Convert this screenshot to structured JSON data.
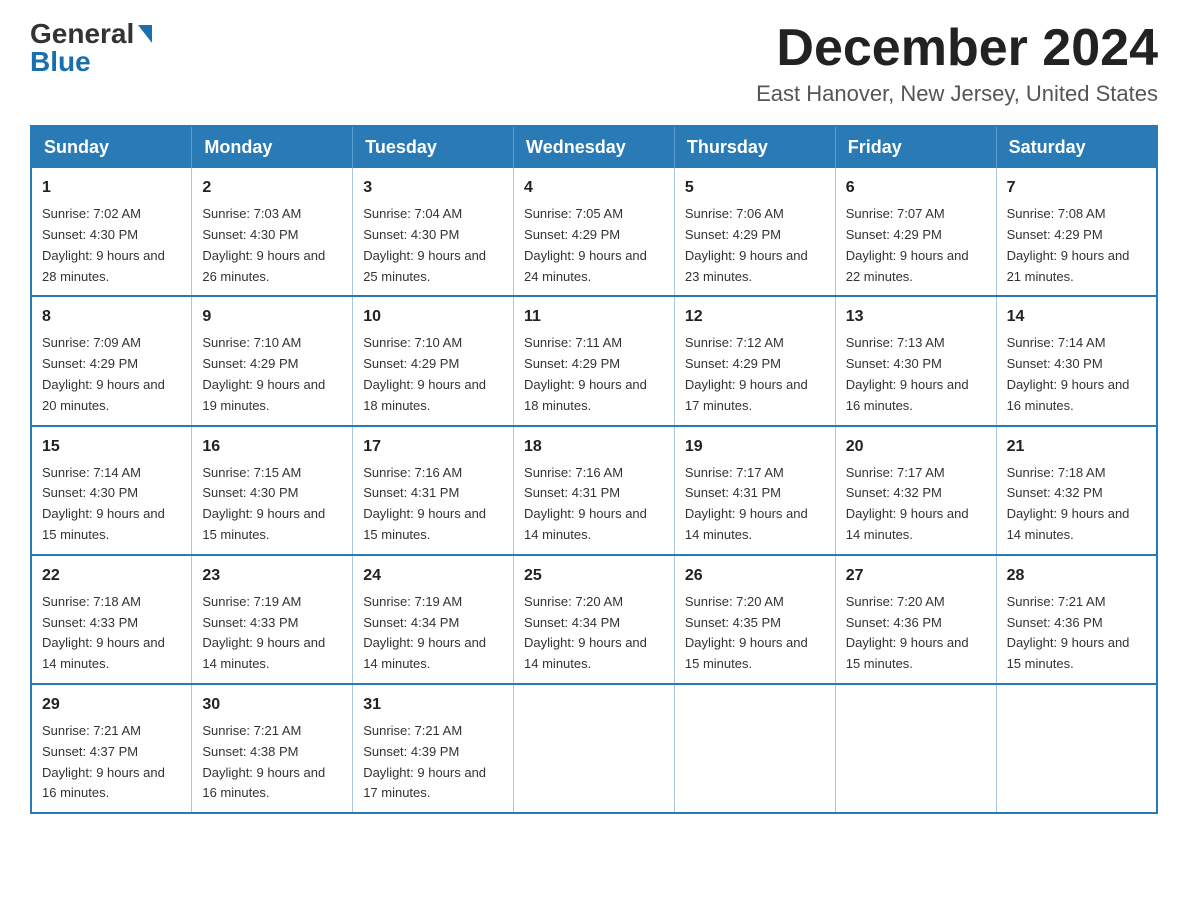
{
  "logo": {
    "general": "General",
    "blue": "Blue"
  },
  "title": {
    "month": "December 2024",
    "location": "East Hanover, New Jersey, United States"
  },
  "days_of_week": [
    "Sunday",
    "Monday",
    "Tuesday",
    "Wednesday",
    "Thursday",
    "Friday",
    "Saturday"
  ],
  "weeks": [
    [
      {
        "day": "1",
        "sunrise": "7:02 AM",
        "sunset": "4:30 PM",
        "daylight": "9 hours and 28 minutes."
      },
      {
        "day": "2",
        "sunrise": "7:03 AM",
        "sunset": "4:30 PM",
        "daylight": "9 hours and 26 minutes."
      },
      {
        "day": "3",
        "sunrise": "7:04 AM",
        "sunset": "4:30 PM",
        "daylight": "9 hours and 25 minutes."
      },
      {
        "day": "4",
        "sunrise": "7:05 AM",
        "sunset": "4:29 PM",
        "daylight": "9 hours and 24 minutes."
      },
      {
        "day": "5",
        "sunrise": "7:06 AM",
        "sunset": "4:29 PM",
        "daylight": "9 hours and 23 minutes."
      },
      {
        "day": "6",
        "sunrise": "7:07 AM",
        "sunset": "4:29 PM",
        "daylight": "9 hours and 22 minutes."
      },
      {
        "day": "7",
        "sunrise": "7:08 AM",
        "sunset": "4:29 PM",
        "daylight": "9 hours and 21 minutes."
      }
    ],
    [
      {
        "day": "8",
        "sunrise": "7:09 AM",
        "sunset": "4:29 PM",
        "daylight": "9 hours and 20 minutes."
      },
      {
        "day": "9",
        "sunrise": "7:10 AM",
        "sunset": "4:29 PM",
        "daylight": "9 hours and 19 minutes."
      },
      {
        "day": "10",
        "sunrise": "7:10 AM",
        "sunset": "4:29 PM",
        "daylight": "9 hours and 18 minutes."
      },
      {
        "day": "11",
        "sunrise": "7:11 AM",
        "sunset": "4:29 PM",
        "daylight": "9 hours and 18 minutes."
      },
      {
        "day": "12",
        "sunrise": "7:12 AM",
        "sunset": "4:29 PM",
        "daylight": "9 hours and 17 minutes."
      },
      {
        "day": "13",
        "sunrise": "7:13 AM",
        "sunset": "4:30 PM",
        "daylight": "9 hours and 16 minutes."
      },
      {
        "day": "14",
        "sunrise": "7:14 AM",
        "sunset": "4:30 PM",
        "daylight": "9 hours and 16 minutes."
      }
    ],
    [
      {
        "day": "15",
        "sunrise": "7:14 AM",
        "sunset": "4:30 PM",
        "daylight": "9 hours and 15 minutes."
      },
      {
        "day": "16",
        "sunrise": "7:15 AM",
        "sunset": "4:30 PM",
        "daylight": "9 hours and 15 minutes."
      },
      {
        "day": "17",
        "sunrise": "7:16 AM",
        "sunset": "4:31 PM",
        "daylight": "9 hours and 15 minutes."
      },
      {
        "day": "18",
        "sunrise": "7:16 AM",
        "sunset": "4:31 PM",
        "daylight": "9 hours and 14 minutes."
      },
      {
        "day": "19",
        "sunrise": "7:17 AM",
        "sunset": "4:31 PM",
        "daylight": "9 hours and 14 minutes."
      },
      {
        "day": "20",
        "sunrise": "7:17 AM",
        "sunset": "4:32 PM",
        "daylight": "9 hours and 14 minutes."
      },
      {
        "day": "21",
        "sunrise": "7:18 AM",
        "sunset": "4:32 PM",
        "daylight": "9 hours and 14 minutes."
      }
    ],
    [
      {
        "day": "22",
        "sunrise": "7:18 AM",
        "sunset": "4:33 PM",
        "daylight": "9 hours and 14 minutes."
      },
      {
        "day": "23",
        "sunrise": "7:19 AM",
        "sunset": "4:33 PM",
        "daylight": "9 hours and 14 minutes."
      },
      {
        "day": "24",
        "sunrise": "7:19 AM",
        "sunset": "4:34 PM",
        "daylight": "9 hours and 14 minutes."
      },
      {
        "day": "25",
        "sunrise": "7:20 AM",
        "sunset": "4:34 PM",
        "daylight": "9 hours and 14 minutes."
      },
      {
        "day": "26",
        "sunrise": "7:20 AM",
        "sunset": "4:35 PM",
        "daylight": "9 hours and 15 minutes."
      },
      {
        "day": "27",
        "sunrise": "7:20 AM",
        "sunset": "4:36 PM",
        "daylight": "9 hours and 15 minutes."
      },
      {
        "day": "28",
        "sunrise": "7:21 AM",
        "sunset": "4:36 PM",
        "daylight": "9 hours and 15 minutes."
      }
    ],
    [
      {
        "day": "29",
        "sunrise": "7:21 AM",
        "sunset": "4:37 PM",
        "daylight": "9 hours and 16 minutes."
      },
      {
        "day": "30",
        "sunrise": "7:21 AM",
        "sunset": "4:38 PM",
        "daylight": "9 hours and 16 minutes."
      },
      {
        "day": "31",
        "sunrise": "7:21 AM",
        "sunset": "4:39 PM",
        "daylight": "9 hours and 17 minutes."
      },
      null,
      null,
      null,
      null
    ]
  ],
  "labels": {
    "sunrise": "Sunrise:",
    "sunset": "Sunset:",
    "daylight": "Daylight:"
  }
}
